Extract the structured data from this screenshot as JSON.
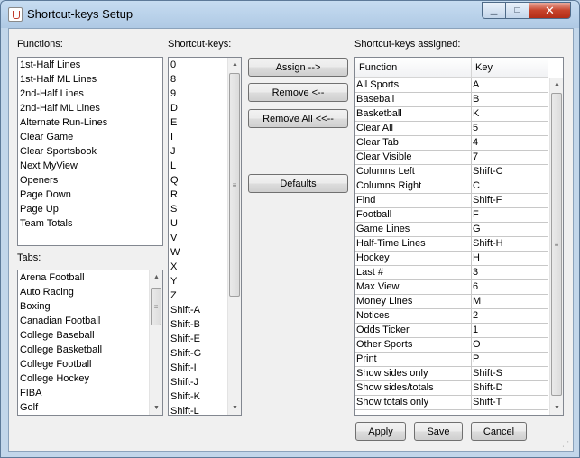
{
  "window": {
    "title": "Shortcut-keys Setup",
    "min_symbol": "▁",
    "max_symbol": "□",
    "close_symbol": "✕"
  },
  "functions": {
    "label": "Functions:",
    "items": [
      "1st-Half Lines",
      "1st-Half ML Lines",
      "2nd-Half Lines",
      "2nd-Half ML Lines",
      "Alternate Run-Lines",
      "Clear Game",
      "Clear Sportsbook",
      "Next MyView",
      "Openers",
      "Page Down",
      "Page Up",
      "Team Totals"
    ]
  },
  "tabs": {
    "label": "Tabs:",
    "items": [
      "Arena Football",
      "Auto Racing",
      "Boxing",
      "Canadian Football",
      "College Baseball",
      "College Basketball",
      "College Football",
      "College Hockey",
      "FIBA",
      "Golf"
    ]
  },
  "shortcut_keys": {
    "label": "Shortcut-keys:",
    "items": [
      "0",
      "8",
      "9",
      "D",
      "E",
      "I",
      "J",
      "L",
      "Q",
      "R",
      "S",
      "U",
      "V",
      "W",
      "X",
      "Y",
      "Z",
      "Shift-A",
      "Shift-B",
      "Shift-E",
      "Shift-G",
      "Shift-I",
      "Shift-J",
      "Shift-K",
      "Shift-L"
    ]
  },
  "buttons": {
    "assign": "Assign -->",
    "remove": "Remove <--",
    "remove_all": "Remove All <<--",
    "defaults": "Defaults",
    "apply": "Apply",
    "save": "Save",
    "cancel": "Cancel"
  },
  "assigned": {
    "label": "Shortcut-keys assigned:",
    "columns": [
      "Function",
      "Key"
    ],
    "rows": [
      [
        "All Sports",
        "A"
      ],
      [
        "Baseball",
        "B"
      ],
      [
        "Basketball",
        "K"
      ],
      [
        "Clear All",
        "5"
      ],
      [
        "Clear Tab",
        "4"
      ],
      [
        "Clear Visible",
        "7"
      ],
      [
        "Columns Left",
        "Shift-C"
      ],
      [
        "Columns Right",
        "C"
      ],
      [
        "Find",
        "Shift-F"
      ],
      [
        "Football",
        "F"
      ],
      [
        "Game Lines",
        "G"
      ],
      [
        "Half-Time Lines",
        "Shift-H"
      ],
      [
        "Hockey",
        "H"
      ],
      [
        "Last #",
        "3"
      ],
      [
        "Max View",
        "6"
      ],
      [
        "Money Lines",
        "M"
      ],
      [
        "Notices",
        "2"
      ],
      [
        "Odds Ticker",
        "1"
      ],
      [
        "Other Sports",
        "O"
      ],
      [
        "Print",
        "P"
      ],
      [
        "Show sides only",
        "Shift-S"
      ],
      [
        "Show sides/totals",
        "Shift-D"
      ],
      [
        "Show totals only",
        "Shift-T"
      ]
    ]
  },
  "icons": {
    "scroll_up": "▲",
    "scroll_down": "▼",
    "thumb_grip": "≡",
    "resize_grip": "⋰"
  }
}
